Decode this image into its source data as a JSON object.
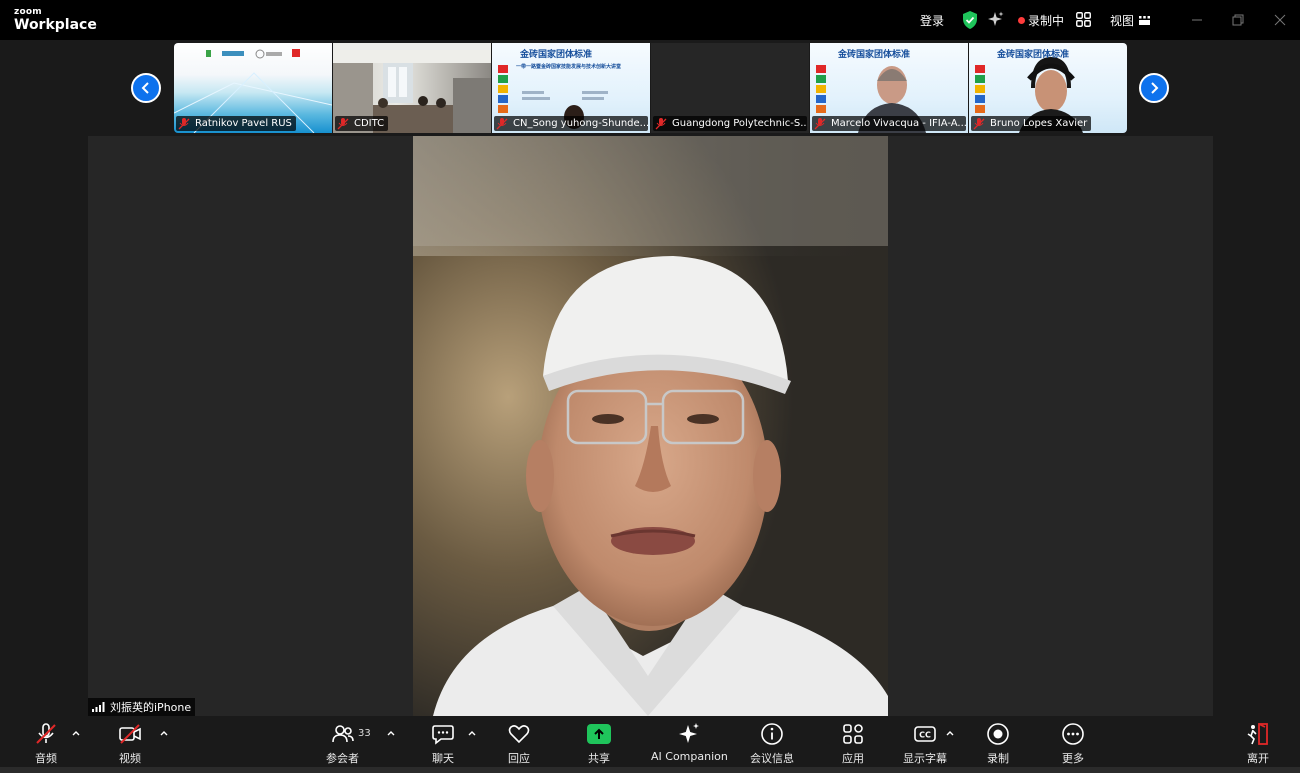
{
  "titlebar": {
    "brand_top": "zoom",
    "brand_bottom": "Workplace",
    "login": "登录",
    "recording": "录制中",
    "view": "视图"
  },
  "gallery": {
    "tiles": [
      {
        "name": "Ratnikov Pavel RUS"
      },
      {
        "name": "CDITC"
      },
      {
        "name": "CN_Song yuhong-Shunde..."
      },
      {
        "name": "Guangdong Polytechnic-S..."
      },
      {
        "name": "Marcelo Vivacqua - IFIA-A..."
      },
      {
        "name": "Bruno Lopes Xavier"
      }
    ],
    "slide_title": "金砖国家团体标准",
    "slide_sub": "一带一路暨金砖国家技能发展与技术创新大讲堂"
  },
  "stage": {
    "speaker_label": "刘振英的iPhone"
  },
  "toolbar": {
    "audio": "音频",
    "video": "视频",
    "participants": "参会者",
    "participant_count": "33",
    "chat": "聊天",
    "react": "回应",
    "share": "共享",
    "ai_companion": "AI Companion",
    "meeting_info": "会议信息",
    "apps": "应用",
    "captions": "显示字幕",
    "record": "录制",
    "more": "更多",
    "leave": "离开"
  },
  "colors": {
    "accent_blue": "#0e72ed",
    "share_green": "#1fc45b",
    "muted_red": "#e02828",
    "shield_green": "#1fc45b",
    "recording_red": "#ff3b3b"
  }
}
